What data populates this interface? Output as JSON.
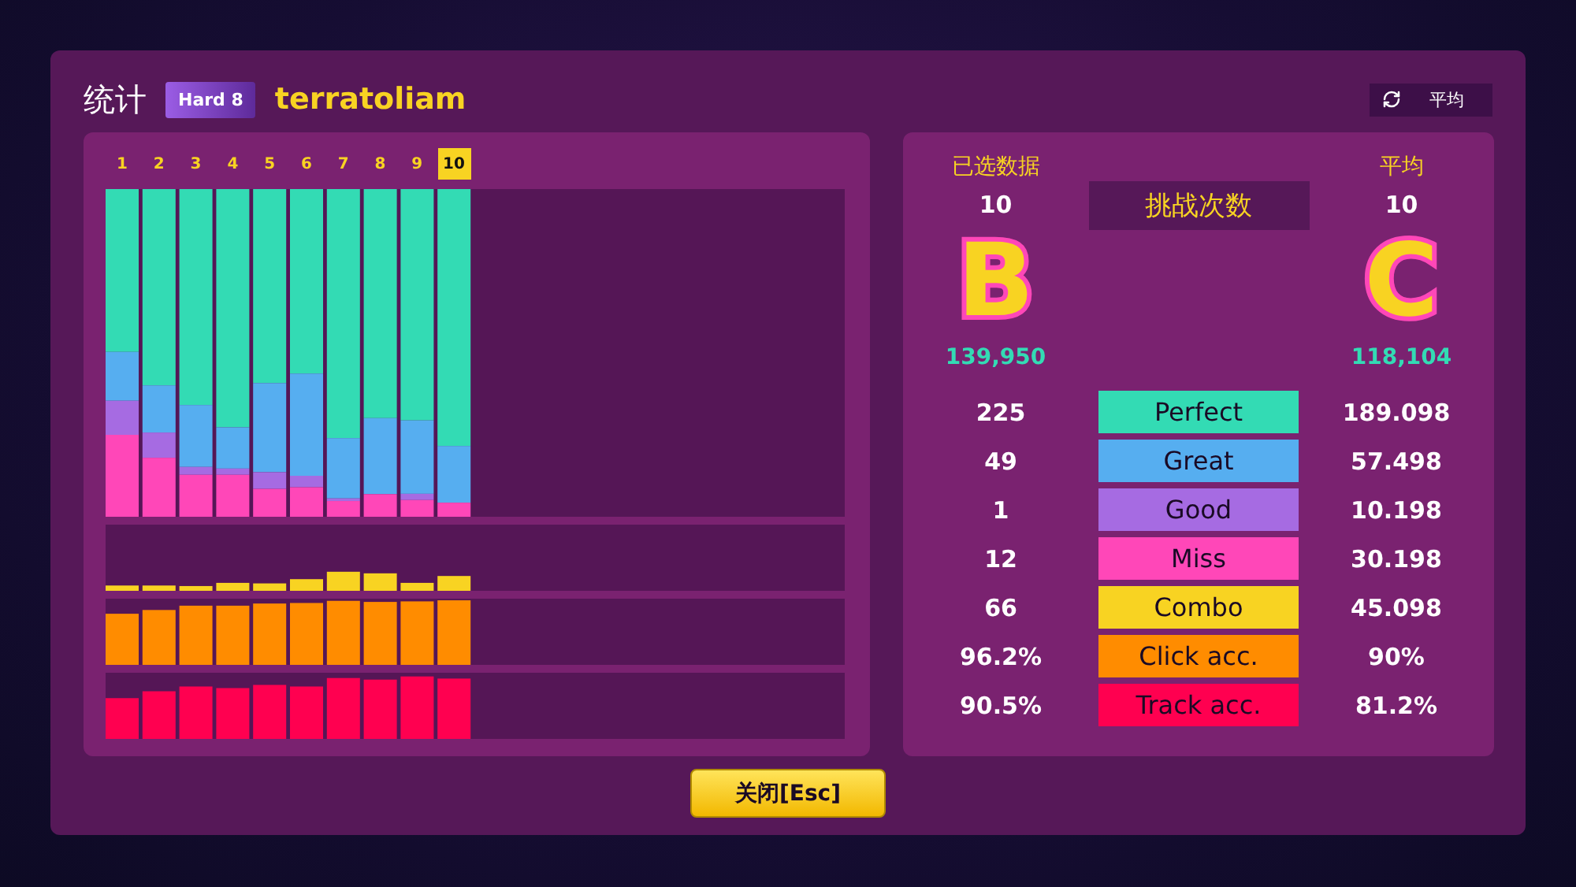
{
  "dialog": {
    "title": "统计",
    "difficulty_badge": "Hard 8",
    "song_title": "terratoliam",
    "mode_button": {
      "label": "平均"
    }
  },
  "attempts": [
    {
      "label": "1",
      "selected": false
    },
    {
      "label": "2",
      "selected": false
    },
    {
      "label": "3",
      "selected": false
    },
    {
      "label": "4",
      "selected": false
    },
    {
      "label": "5",
      "selected": false
    },
    {
      "label": "6",
      "selected": false
    },
    {
      "label": "7",
      "selected": false
    },
    {
      "label": "8",
      "selected": false
    },
    {
      "label": "9",
      "selected": false
    },
    {
      "label": "10",
      "selected": true
    }
  ],
  "summary": {
    "selected": {
      "heading": "已选数据",
      "count": "10",
      "grade": "B",
      "score": "139,950"
    },
    "center_label": "挑战次数",
    "average": {
      "heading": "平均",
      "count": "10",
      "grade": "C",
      "score": "118,104"
    }
  },
  "stats": [
    {
      "label": "Perfect",
      "color": "#33dbb4",
      "selected_value": "225",
      "average_value": "189.098"
    },
    {
      "label": "Great",
      "color": "#56aef0",
      "selected_value": "49",
      "average_value": "57.498"
    },
    {
      "label": "Good",
      "color": "#a66be2",
      "selected_value": "1",
      "average_value": "10.198"
    },
    {
      "label": "Miss",
      "color": "#ff47b8",
      "selected_value": "12",
      "average_value": "30.198"
    },
    {
      "label": "Combo",
      "color": "#f8d322",
      "selected_value": "66",
      "average_value": "45.098"
    },
    {
      "label": "Click acc.",
      "color": "#ff8c00",
      "selected_value": "96.2%",
      "average_value": "90%"
    },
    {
      "label": "Track acc.",
      "color": "#ff0050",
      "selected_value": "90.5%",
      "average_value": "81.2%"
    }
  ],
  "close_button": {
    "label": "关闭[Esc]"
  }
}
